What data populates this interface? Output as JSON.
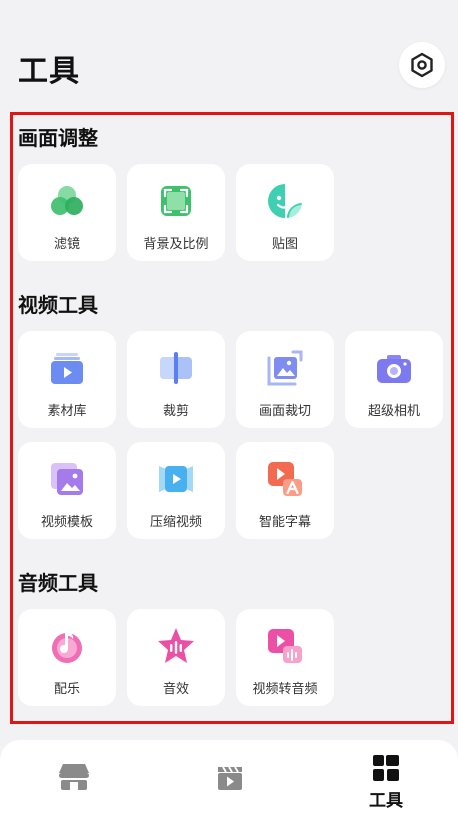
{
  "header": {
    "title": "工具"
  },
  "sections": [
    {
      "title": "画面调整",
      "items": [
        {
          "label": "滤镜",
          "icon": "filter-icon"
        },
        {
          "label": "背景及比例",
          "icon": "background-ratio-icon"
        },
        {
          "label": "贴图",
          "icon": "sticker-icon"
        }
      ]
    },
    {
      "title": "视频工具",
      "items": [
        {
          "label": "素材库",
          "icon": "material-library-icon"
        },
        {
          "label": "裁剪",
          "icon": "trim-icon"
        },
        {
          "label": "画面裁切",
          "icon": "crop-icon"
        },
        {
          "label": "超级相机",
          "icon": "camera-icon"
        },
        {
          "label": "视频模板",
          "icon": "video-template-icon"
        },
        {
          "label": "压缩视频",
          "icon": "compress-video-icon"
        },
        {
          "label": "智能字幕",
          "icon": "smart-subtitle-icon"
        }
      ]
    },
    {
      "title": "音频工具",
      "items": [
        {
          "label": "配乐",
          "icon": "music-icon"
        },
        {
          "label": "音效",
          "icon": "sound-effect-icon"
        },
        {
          "label": "视频转音频",
          "icon": "video-to-audio-icon"
        }
      ]
    }
  ],
  "bottom_nav": {
    "items": [
      {
        "icon": "shop-icon",
        "active": false
      },
      {
        "icon": "video-clapper-icon",
        "active": false
      },
      {
        "label": "工具",
        "icon": "tools-grid-icon",
        "active": true
      }
    ]
  },
  "colors": {
    "highlight_border": "#e01515",
    "background": "#f2f2f4",
    "card": "#ffffff",
    "nav_inactive": "#8a8a8a",
    "nav_active": "#111111"
  }
}
